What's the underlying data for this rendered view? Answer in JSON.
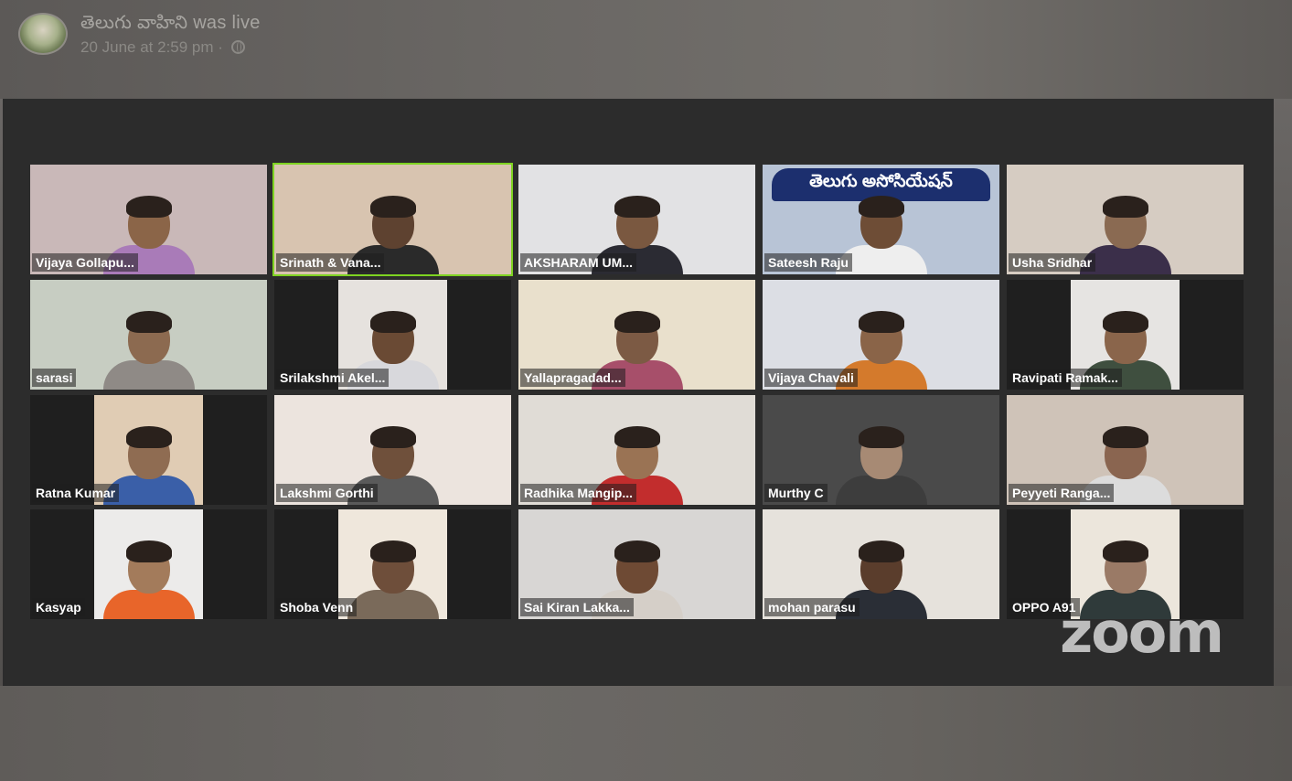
{
  "post": {
    "page_name": "తెలుగు వాహిని",
    "status": "was live",
    "date": "20 June at 2:59 pm",
    "separator": "·",
    "icons": {
      "avatar": "page-avatar",
      "privacy": "globe-icon"
    }
  },
  "meeting": {
    "logo": "zoom",
    "active_speaker_color": "#7ed321",
    "participants": [
      {
        "name": "Vijaya Gollapu...",
        "bg": "#c9b8b8",
        "skin": "#8b6548",
        "shirt": "#a97bb8",
        "narrow": false
      },
      {
        "name": "Srinath & Vana...",
        "bg": "#d8c4b0",
        "skin": "#5e4230",
        "shirt": "#2a2a2a",
        "narrow": false,
        "active": true
      },
      {
        "name": "AKSHARAM UM...",
        "bg": "#e2e2e4",
        "skin": "#7a5840",
        "shirt": "#2b2b33",
        "narrow": false
      },
      {
        "name": "Sateesh Raju",
        "bg": "#b8c4d6",
        "skin": "#6e4d36",
        "shirt": "#eeeeee",
        "narrow": false,
        "banner": "తెలుగు అసోసియేషన్"
      },
      {
        "name": "Usha Sridhar",
        "bg": "#d6ccc2",
        "skin": "#8a6a52",
        "shirt": "#3b2f4a",
        "narrow": false
      },
      {
        "name": "sarasi",
        "bg": "#c7cdc2",
        "skin": "#8c6a50",
        "shirt": "#8f8a86",
        "narrow": false
      },
      {
        "name": "Srilakshmi Akel...",
        "bg": "#e6e2de",
        "skin": "#6a4a34",
        "shirt": "#d8d8dc",
        "narrow": true
      },
      {
        "name": "Yallapragadad...",
        "bg": "#e9e0cc",
        "skin": "#7c5a44",
        "shirt": "#a74f6a",
        "narrow": false
      },
      {
        "name": "Vijaya Chavali",
        "bg": "#dcdee4",
        "skin": "#8a6448",
        "shirt": "#d47a2c",
        "narrow": false
      },
      {
        "name": "Ravipati Ramak...",
        "bg": "#e6e4e2",
        "skin": "#8a654b",
        "shirt": "#3f4f3f",
        "narrow": true
      },
      {
        "name": "Ratna Kumar",
        "bg": "#e0ccb4",
        "skin": "#8f6c52",
        "shirt": "#3a5fa8",
        "narrow": true
      },
      {
        "name": "Lakshmi Gorthi",
        "bg": "#ece4de",
        "skin": "#6f503b",
        "shirt": "#5a5a5a",
        "narrow": false
      },
      {
        "name": "Radhika Mangip...",
        "bg": "#e0dcd6",
        "skin": "#9a7354",
        "shirt": "#c22d2d",
        "narrow": false
      },
      {
        "name": "Murthy C",
        "bg": "#4a4a4a",
        "skin": "#a78a74",
        "shirt": "#3d3d3d",
        "narrow": false
      },
      {
        "name": "Peyyeti Ranga...",
        "bg": "#cfc3b8",
        "skin": "#8a6550",
        "shirt": "#dcdcdc",
        "narrow": false
      },
      {
        "name": "Kasyap",
        "bg": "#ecebea",
        "skin": "#a37b5b",
        "shirt": "#e8652a",
        "narrow": true
      },
      {
        "name": "Shoba Venn",
        "bg": "#efe7dc",
        "skin": "#6e4e3a",
        "shirt": "#7a6a5a",
        "narrow": true
      },
      {
        "name": "Sai Kiran Lakka...",
        "bg": "#d8d6d4",
        "skin": "#6e4a34",
        "shirt": "#d5cfc8",
        "narrow": false
      },
      {
        "name": "mohan parasu",
        "bg": "#e6e2dc",
        "skin": "#5a3d2c",
        "shirt": "#2a2e36",
        "narrow": false
      },
      {
        "name": "OPPO A91",
        "bg": "#ece6dc",
        "skin": "#9a7a66",
        "shirt": "#2f3a3a",
        "narrow": true
      }
    ]
  }
}
